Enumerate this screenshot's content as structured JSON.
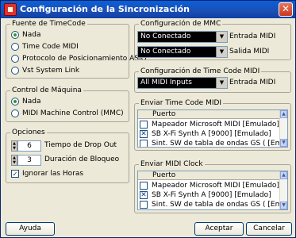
{
  "window": {
    "title": "Configuración de la Sincronización",
    "close_glyph": "✕"
  },
  "timecode_source": {
    "legend": "Fuente de TimeCode",
    "options": [
      "Nada",
      "Time Code MIDI",
      "Protocolo de Posicionamiento ASIO",
      "Vst System Link"
    ],
    "selected_index": 0
  },
  "machine_control": {
    "legend": "Control de Máquina",
    "options": [
      "Nada",
      "MIDI Machine Control (MMC)"
    ],
    "selected_index": 0
  },
  "options": {
    "legend": "Opciones",
    "drop_out_value": "6",
    "drop_out_label": "Tiempo de Drop Out",
    "lock_value": "3",
    "lock_label": "Duración de Bloqueo",
    "ignore_hours_label": "Ignorar las Horas",
    "ignore_hours_checked": true
  },
  "mmc_config": {
    "legend": "Configuración de MMC",
    "midi_in_value": "No Conectado",
    "midi_in_label": "Entrada MIDI",
    "midi_out_value": "No Conectado",
    "midi_out_label": "Salida MIDI"
  },
  "timecode_midi_config": {
    "legend": "Configuración de Time Code MIDI",
    "input_value": "All MIDI Inputs",
    "input_label": "Entrada MIDI"
  },
  "send_timecode": {
    "legend": "Enviar Time Code MIDI",
    "column_header": "Puerto",
    "ports": [
      {
        "name": "Mapeador Microsoft MIDI [Emulado]",
        "checked": false
      },
      {
        "name": "SB X-Fi Synth A [9000] [Emulado]",
        "checked": true
      },
      {
        "name": "Sint. SW de tabla de ondas GS ( [Emulado]",
        "checked": false
      }
    ]
  },
  "send_clock": {
    "legend": "Enviar MIDI Clock",
    "column_header": "Puerto",
    "ports": [
      {
        "name": "Mapeador Microsoft MIDI [Emulado]",
        "checked": false
      },
      {
        "name": "SB X-Fi Synth A [9000] [Emulado]",
        "checked": true
      },
      {
        "name": "Sint. SW de tabla de ondas GS ( [Emulado]",
        "checked": false
      }
    ]
  },
  "buttons": {
    "help": "Ayuda",
    "accept": "Aceptar",
    "cancel": "Cancelar"
  },
  "glyphs": {
    "dropdown": "▼",
    "scroll_up": "▲",
    "scroll_down": "▼",
    "check": "✓",
    "checked_box": "✕",
    "spin_up": "▲",
    "spin_down": "▼"
  }
}
